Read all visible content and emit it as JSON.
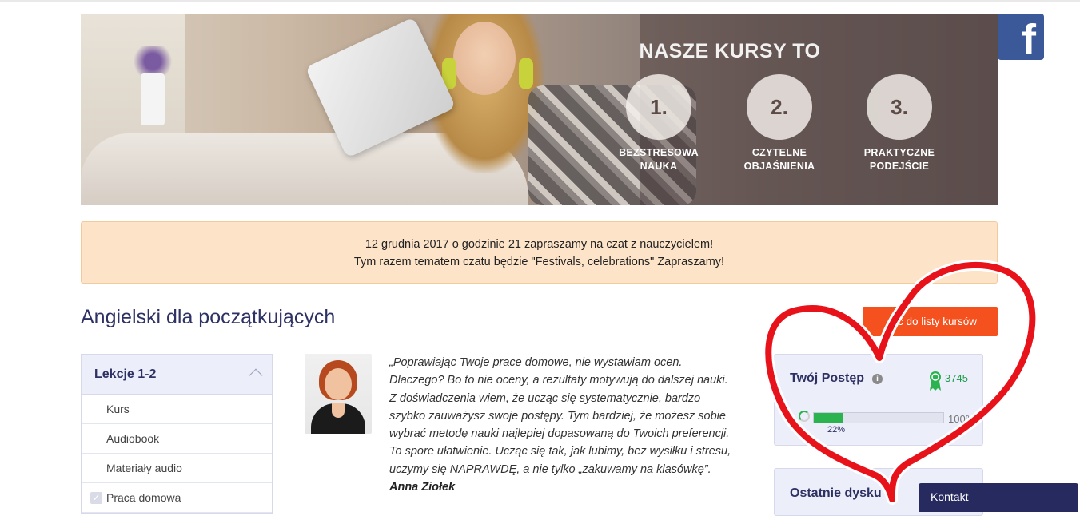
{
  "banner": {
    "title": "NASZE KURSY TO",
    "steps": [
      {
        "number": "1.",
        "label": "BEZSTRESOWA\nNAUKA"
      },
      {
        "number": "2.",
        "label": "CZYTELNE\nOBJAŚNIENIA"
      },
      {
        "number": "3.",
        "label": "PRAKTYCZNE\nPODEJŚCIE"
      }
    ]
  },
  "social": {
    "facebook_label": "f"
  },
  "notice": {
    "line1": "12 grudnia 2017 o godzinie 21 zapraszamy na czat z nauczycielem!",
    "line2": "Tym razem tematem czatu będzie \"Festivals, celebrations\" Zapraszamy!"
  },
  "course": {
    "title": "Angielski dla początkujących",
    "back_button": "ć do listy kursów"
  },
  "lessons": {
    "header": "Lekcje 1-2",
    "items": [
      {
        "label": "Kurs",
        "checked": false
      },
      {
        "label": "Audiobook",
        "checked": false
      },
      {
        "label": "Materiały audio",
        "checked": false
      },
      {
        "label": "Praca domowa",
        "checked": true
      }
    ]
  },
  "quote": {
    "lines": [
      "„Poprawiając Twoje prace domowe, nie wystawiam ocen.",
      "Dlaczego? Bo to nie oceny, a rezultaty motywują do dalszej nauki.",
      "Z doświadczenia wiem, że ucząc się systematycznie, bardzo",
      "szybko zauważysz swoje postępy. Tym bardziej, że możesz sobie",
      "wybrać metodę nauki najlepiej dopasowaną do Twoich preferencji.",
      "To spore ułatwienie. Ucząc się tak, jak lubimy, bez wysiłku i stresu,",
      "uczymy się NAPRAWDĘ, a nie tylko „zakuwamy na klasówkę”."
    ],
    "author": "Anna Ziołek"
  },
  "progress": {
    "title": "Twój Postęp",
    "info_icon": "i",
    "points": "3745",
    "percent_label": "22%",
    "percent_value": 22,
    "max_label": "100%"
  },
  "discussions": {
    "title": "Ostatnie dysku  :"
  },
  "kontakt": {
    "label": "Kontakt"
  },
  "colors": {
    "accent_orange": "#f4511e",
    "navy": "#2e3163",
    "progress_green": "#2ab34f",
    "notice_bg": "#fde3c8",
    "annotation_red": "#e8131a"
  }
}
